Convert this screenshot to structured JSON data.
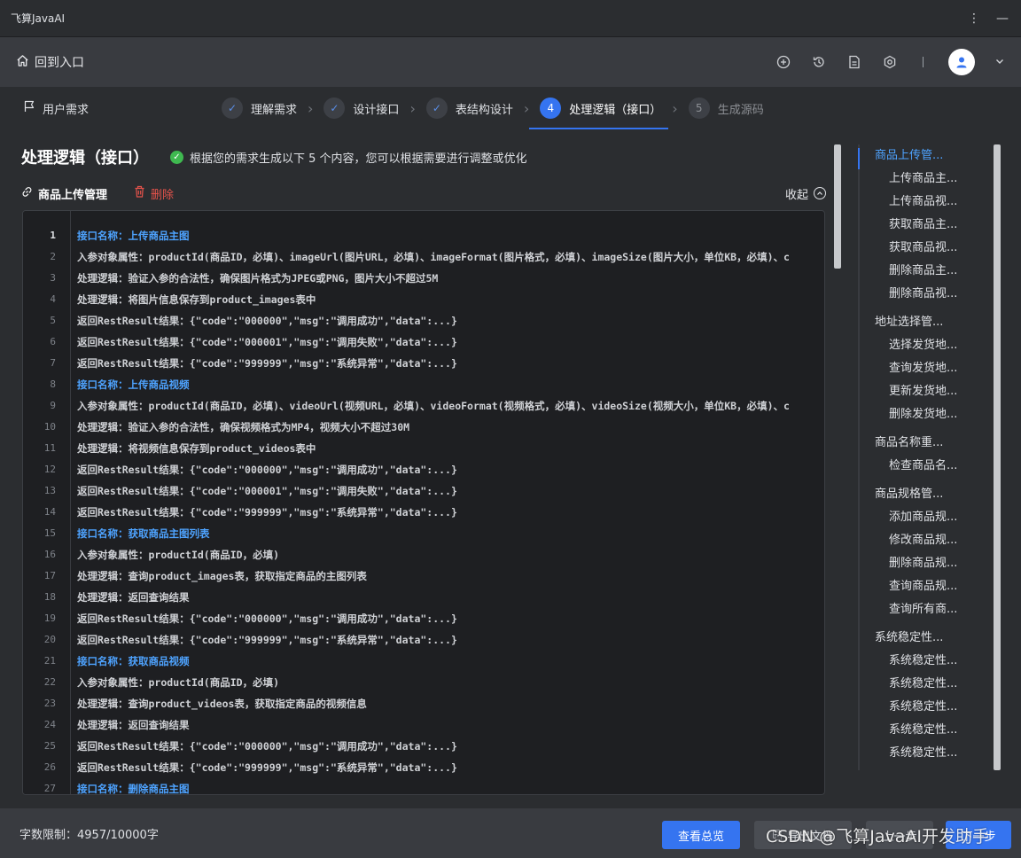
{
  "app": {
    "title": "飞算JavaAI"
  },
  "header": {
    "back_label": "回到入口",
    "icons": [
      "add-circle-icon",
      "history-icon",
      "document-icon",
      "settings-icon"
    ]
  },
  "steps": {
    "requirement_label": "用户需求",
    "items": [
      {
        "num": "✓",
        "label": "理解需求",
        "state": "done"
      },
      {
        "num": "✓",
        "label": "设计接口",
        "state": "done"
      },
      {
        "num": "✓",
        "label": "表结构设计",
        "state": "done"
      },
      {
        "num": "4",
        "label": "处理逻辑（接口）",
        "state": "active"
      },
      {
        "num": "5",
        "label": "生成源码",
        "state": "todo"
      }
    ]
  },
  "main": {
    "title": "处理逻辑（接口）",
    "notice": "根据您的需求生成以下 5 个内容，您可以根据需要进行调整或优化",
    "module_name": "商品上传管理",
    "delete_label": "删除",
    "collapse_label": "收起"
  },
  "editor": {
    "lines": [
      {
        "n": "1",
        "t": "接口名称：上传商品主图",
        "api": true
      },
      {
        "n": "2",
        "t": "入参对象属性：productId(商品ID，必填)、imageUrl(图片URL，必填)、imageFormat(图片格式，必填)、imageSize(图片大小，单位KB，必填)、c"
      },
      {
        "n": "3",
        "t": "处理逻辑：验证入参的合法性，确保图片格式为JPEG或PNG，图片大小不超过5M"
      },
      {
        "n": "4",
        "t": "处理逻辑：将图片信息保存到product_images表中"
      },
      {
        "n": "5",
        "t": "返回RestResult结果：{\"code\":\"000000\",\"msg\":\"调用成功\",\"data\":...}"
      },
      {
        "n": "6",
        "t": "返回RestResult结果：{\"code\":\"000001\",\"msg\":\"调用失败\",\"data\":...}"
      },
      {
        "n": "7",
        "t": "返回RestResult结果：{\"code\":\"999999\",\"msg\":\"系统异常\",\"data\":...}"
      },
      {
        "n": "8",
        "t": "接口名称：上传商品视频",
        "api": true
      },
      {
        "n": "9",
        "t": "入参对象属性：productId(商品ID，必填)、videoUrl(视频URL，必填)、videoFormat(视频格式，必填)、videoSize(视频大小，单位KB，必填)、c"
      },
      {
        "n": "10",
        "t": "处理逻辑：验证入参的合法性，确保视频格式为MP4，视频大小不超过30M"
      },
      {
        "n": "11",
        "t": "处理逻辑：将视频信息保存到product_videos表中"
      },
      {
        "n": "12",
        "t": "返回RestResult结果：{\"code\":\"000000\",\"msg\":\"调用成功\",\"data\":...}"
      },
      {
        "n": "13",
        "t": "返回RestResult结果：{\"code\":\"000001\",\"msg\":\"调用失败\",\"data\":...}"
      },
      {
        "n": "14",
        "t": "返回RestResult结果：{\"code\":\"999999\",\"msg\":\"系统异常\",\"data\":...}"
      },
      {
        "n": "15",
        "t": "接口名称：获取商品主图列表",
        "api": true
      },
      {
        "n": "16",
        "t": "入参对象属性：productId(商品ID，必填)"
      },
      {
        "n": "17",
        "t": "处理逻辑：查询product_images表，获取指定商品的主图列表"
      },
      {
        "n": "18",
        "t": "处理逻辑：返回查询结果"
      },
      {
        "n": "19",
        "t": "返回RestResult结果：{\"code\":\"000000\",\"msg\":\"调用成功\",\"data\":...}"
      },
      {
        "n": "20",
        "t": "返回RestResult结果：{\"code\":\"999999\",\"msg\":\"系统异常\",\"data\":...}"
      },
      {
        "n": "21",
        "t": "接口名称：获取商品视频",
        "api": true
      },
      {
        "n": "22",
        "t": "入参对象属性：productId(商品ID，必填)"
      },
      {
        "n": "23",
        "t": "处理逻辑：查询product_videos表，获取指定商品的视频信息"
      },
      {
        "n": "24",
        "t": "处理逻辑：返回查询结果"
      },
      {
        "n": "25",
        "t": "返回RestResult结果：{\"code\":\"000000\",\"msg\":\"调用成功\",\"data\":...}"
      },
      {
        "n": "26",
        "t": "返回RestResult结果：{\"code\":\"999999\",\"msg\":\"系统异常\",\"data\":...}"
      },
      {
        "n": "27",
        "t": "接口名称：删除商品主图",
        "api": true
      }
    ]
  },
  "right_nav": {
    "groups": [
      {
        "label": "商品上传管...",
        "active": true,
        "items": [
          "上传商品主...",
          "上传商品视...",
          "获取商品主...",
          "获取商品视...",
          "删除商品主...",
          "删除商品视..."
        ]
      },
      {
        "label": "地址选择管...",
        "items": [
          "选择发货地...",
          "查询发货地...",
          "更新发货地...",
          "删除发货地..."
        ]
      },
      {
        "label": "商品名称重...",
        "items": [
          "检查商品名..."
        ]
      },
      {
        "label": "商品规格管...",
        "items": [
          "添加商品规...",
          "修改商品规...",
          "删除商品规...",
          "查询商品规...",
          "查询所有商..."
        ]
      },
      {
        "label": "系统稳定性...",
        "items": [
          "系统稳定性...",
          "系统稳定性...",
          "系统稳定性...",
          "系统稳定性...",
          "系统稳定性..."
        ]
      }
    ]
  },
  "footer": {
    "char_limit": "字数限制：4957/10000字",
    "overview_label": "查看总览",
    "export_label": "导出文档",
    "prev_label": "上一步",
    "next_label": "下一步"
  },
  "watermark": "CSDN @飞算JavaAI开发助手",
  "colors": {
    "accent": "#3574f0",
    "api_line": "#4ea3ff",
    "danger": "#e5534b",
    "success": "#3fb950"
  }
}
